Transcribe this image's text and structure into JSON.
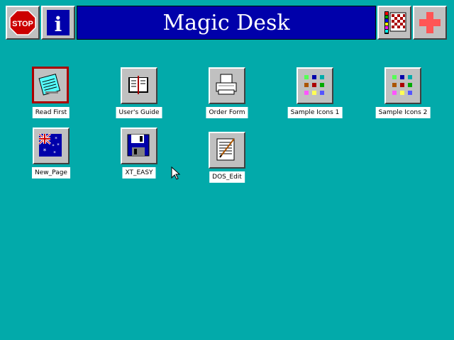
{
  "window": {
    "title": "Magic Desk"
  },
  "toolbar": {
    "stop_label": "STOP",
    "info_label": "i"
  },
  "colors": {
    "desktop": "#02aaaa",
    "title_bar": "#0000aa",
    "title_text": "#ffffff",
    "button_face": "#c0c0c0",
    "label_bg": "#ffffff",
    "selection_border": "#aa0000"
  },
  "icons": [
    {
      "label": "Read First",
      "icon": "notepad-icon",
      "selected": true
    },
    {
      "label": "User's Guide",
      "icon": "book-icon",
      "selected": false
    },
    {
      "label": "Order Form",
      "icon": "printer-icon",
      "selected": false
    },
    {
      "label": "Sample Icons 1",
      "icon": "icon-grid-icon",
      "selected": false
    },
    {
      "label": "Sample Icons 2",
      "icon": "icon-grid-icon",
      "selected": false
    },
    {
      "label": "New_Page",
      "icon": "australian-flag-icon",
      "selected": false
    },
    {
      "label": "XT_EASY",
      "icon": "floppy-disk-icon",
      "selected": false
    },
    {
      "label": "DOS_Edit",
      "icon": "edit-document-icon",
      "selected": false
    }
  ]
}
